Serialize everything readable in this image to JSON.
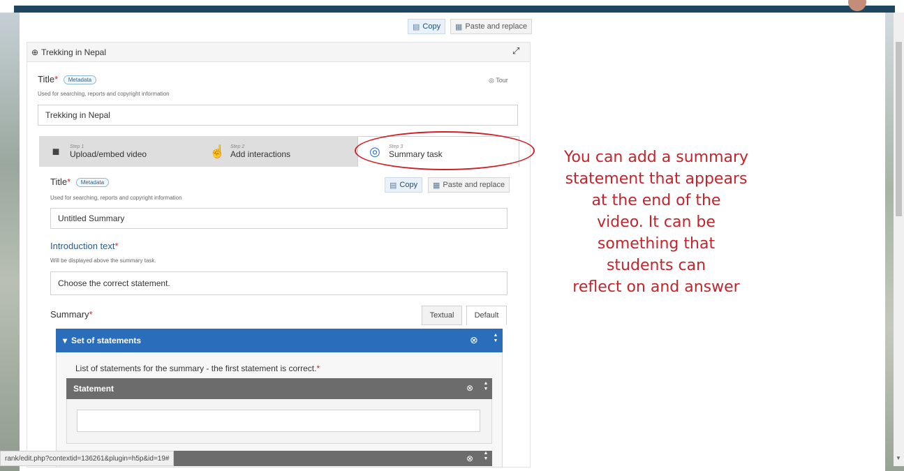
{
  "toolbar": {
    "copy_label": "Copy",
    "paste_label": "Paste and replace"
  },
  "content": {
    "header_title": "Trekking in Nepal",
    "tour_label": "Tour"
  },
  "title_field": {
    "label": "Title",
    "badge": "Metadata",
    "description": "Used for searching, reports and copyright information",
    "value": "Trekking in Nepal"
  },
  "steps": [
    {
      "step": "Step 1",
      "label": "Upload/embed video",
      "icon": "video-camera-icon"
    },
    {
      "step": "Step 2",
      "label": "Add interactions",
      "icon": "hand-pointer-icon"
    },
    {
      "step": "Step 3",
      "label": "Summary task",
      "icon": "check-circle-icon"
    }
  ],
  "summary_task": {
    "title_label": "Title",
    "title_badge": "Metadata",
    "title_description": "Used for searching, reports and copyright information",
    "title_value": "Untitled Summary",
    "copy_label": "Copy",
    "paste_label": "Paste and replace",
    "intro_label": "Introduction text",
    "intro_description": "Will be displayed above the summary task.",
    "intro_value": "Choose the correct statement.",
    "summary_label": "Summary",
    "tab_textual": "Textual",
    "tab_default": "Default",
    "set_label": "Set of statements",
    "list_label": "List of statements for the summary - the first statement is correct.",
    "statement_label": "Statement"
  },
  "annotation": {
    "text": "You can add a summary\nstatement that appears\nat the end of the\nvideo. It can be\nsomething that\nstudents can\nreflect on and answer"
  },
  "status_url": "rank/edit.php?contextid=136261&plugin=h5p&id=19#",
  "colors": {
    "accent": "#2a6ebb",
    "annotation": "#c2252b",
    "header": "#1f4661"
  }
}
